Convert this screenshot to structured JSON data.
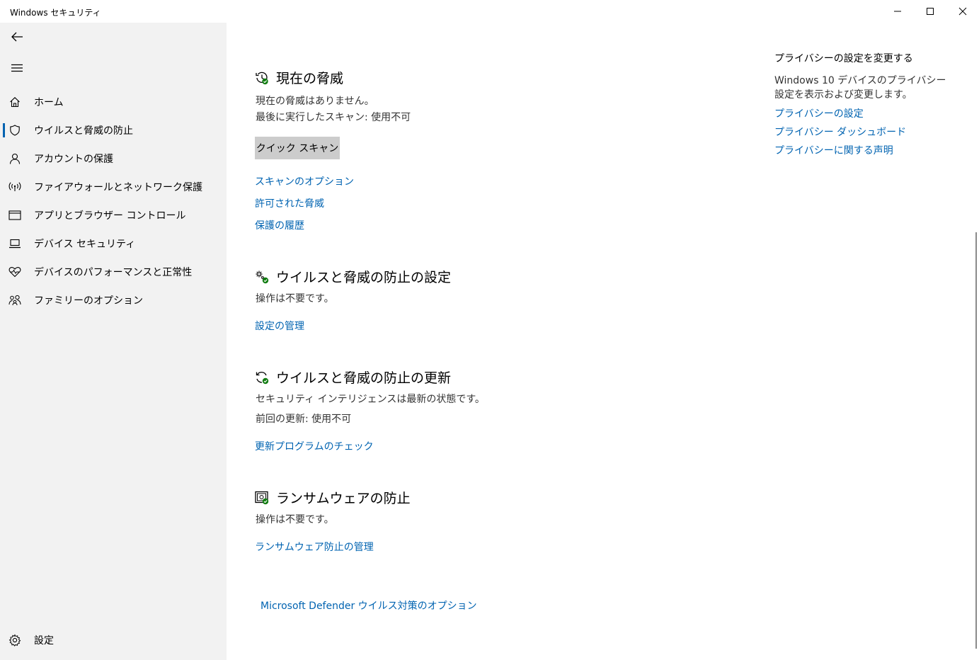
{
  "window": {
    "title": "Windows セキュリティ",
    "minimize_icon": "minimize-icon",
    "maximize_icon": "maximize-icon",
    "close_icon": "close-icon"
  },
  "sidebar": {
    "back_icon": "back-arrow-icon",
    "menu_icon": "hamburger-menu-icon",
    "items": [
      {
        "label": "ホーム",
        "icon": "home-icon"
      },
      {
        "label": "ウイルスと脅威の防止",
        "icon": "shield-icon",
        "selected": true
      },
      {
        "label": "アカウントの保護",
        "icon": "person-icon"
      },
      {
        "label": "ファイアウォールとネットワーク保護",
        "icon": "wireless-icon"
      },
      {
        "label": "アプリとブラウザー コントロール",
        "icon": "app-window-icon"
      },
      {
        "label": "デバイス セキュリティ",
        "icon": "laptop-icon"
      },
      {
        "label": "デバイスのパフォーマンスと正常性",
        "icon": "heart-pulse-icon"
      },
      {
        "label": "ファミリーのオプション",
        "icon": "family-icon"
      }
    ],
    "settings": {
      "label": "設定",
      "icon": "gear-icon"
    }
  },
  "main": {
    "current_threats": {
      "title": "現在の脅威",
      "status": "現在の脅威はありません。",
      "last_scan": "最後に実行したスキャン: 使用不可",
      "quick_scan_button": "クイック スキャン",
      "links": [
        "スキャンのオプション",
        "許可された脅威",
        "保護の履歴"
      ]
    },
    "settings_section": {
      "title": "ウイルスと脅威の防止の設定",
      "status": "操作は不要です。",
      "link": "設定の管理"
    },
    "updates_section": {
      "title": "ウイルスと脅威の防止の更新",
      "status": "セキュリティ インテリジェンスは最新の状態です。",
      "last_update": "前回の更新: 使用不可",
      "link": "更新プログラムのチェック"
    },
    "ransomware_section": {
      "title": "ランサムウェアの防止",
      "status": "操作は不要です。",
      "link": "ランサムウェア防止の管理"
    },
    "defender_link": "Microsoft Defender ウイルス対策のオプション"
  },
  "privacy_panel": {
    "title": "プライバシーの設定を変更する",
    "description": "Windows 10 デバイスのプライバシー設定を表示および変更します。",
    "links": [
      "プライバシーの設定",
      "プライバシー ダッシュボード",
      "プライバシーに関する声明"
    ]
  },
  "colors": {
    "accent": "#0063b1",
    "sidebar_bg": "#f2f2f2",
    "status_ok": "#107c10"
  }
}
